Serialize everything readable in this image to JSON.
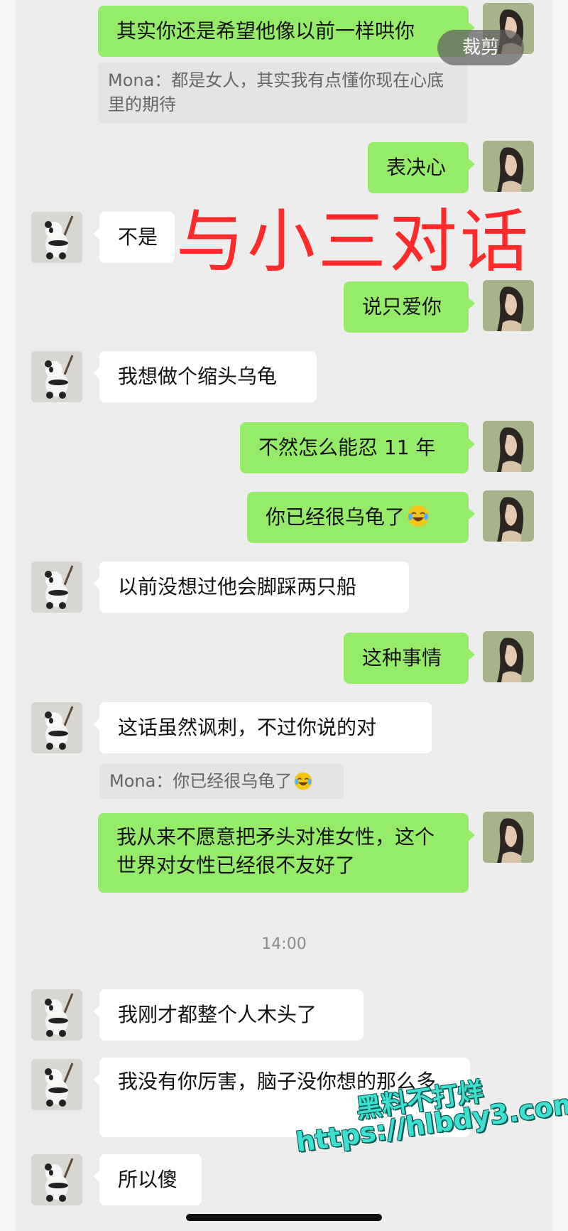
{
  "chat": {
    "messages": [
      {
        "side": "right",
        "text": "其实你还是希望他像以前一样哄你"
      },
      {
        "side": "right",
        "quote": "Mona：都是女人，其实我有点懂你现在心底里的期待"
      },
      {
        "side": "right",
        "text": "表决心"
      },
      {
        "side": "left",
        "text": "不是"
      },
      {
        "side": "right",
        "text": "说只爱你"
      },
      {
        "side": "left",
        "text": "我想做个缩头乌龟"
      },
      {
        "side": "right",
        "text": "不然怎么能忍 11 年"
      },
      {
        "side": "right",
        "text": "你已经很乌龟了",
        "emoji": "laugh-cry"
      },
      {
        "side": "left",
        "text": "以前没想过他会脚踩两只船"
      },
      {
        "side": "right",
        "text": "这种事情"
      },
      {
        "side": "left",
        "text": "这话虽然讽刺，不过你说的对"
      },
      {
        "side": "left",
        "quote": "Mona：你已经很乌龟了",
        "emoji": "laugh-cry"
      },
      {
        "side": "right",
        "text": "我从来不愿意把矛头对准女性，这个世界对女性已经很不友好了"
      },
      {
        "side": "left",
        "text": "我刚才都整个人木头了"
      },
      {
        "side": "left",
        "text": "我没有你厉害，脑子没你想的那么多"
      },
      {
        "side": "left",
        "text": "所以傻"
      }
    ],
    "timestamp": "14:00"
  },
  "overlay": {
    "crop_button": "裁剪",
    "title": "与小三对话",
    "watermark_line1": "黑料不打烊",
    "watermark_line2": "https://hlbdy3.com"
  },
  "colors": {
    "background": "#ededed",
    "bubble_green": "#95ec69",
    "bubble_white": "#ffffff",
    "overlay_red": "#ff2a2a",
    "watermark": "#3de0d0"
  }
}
